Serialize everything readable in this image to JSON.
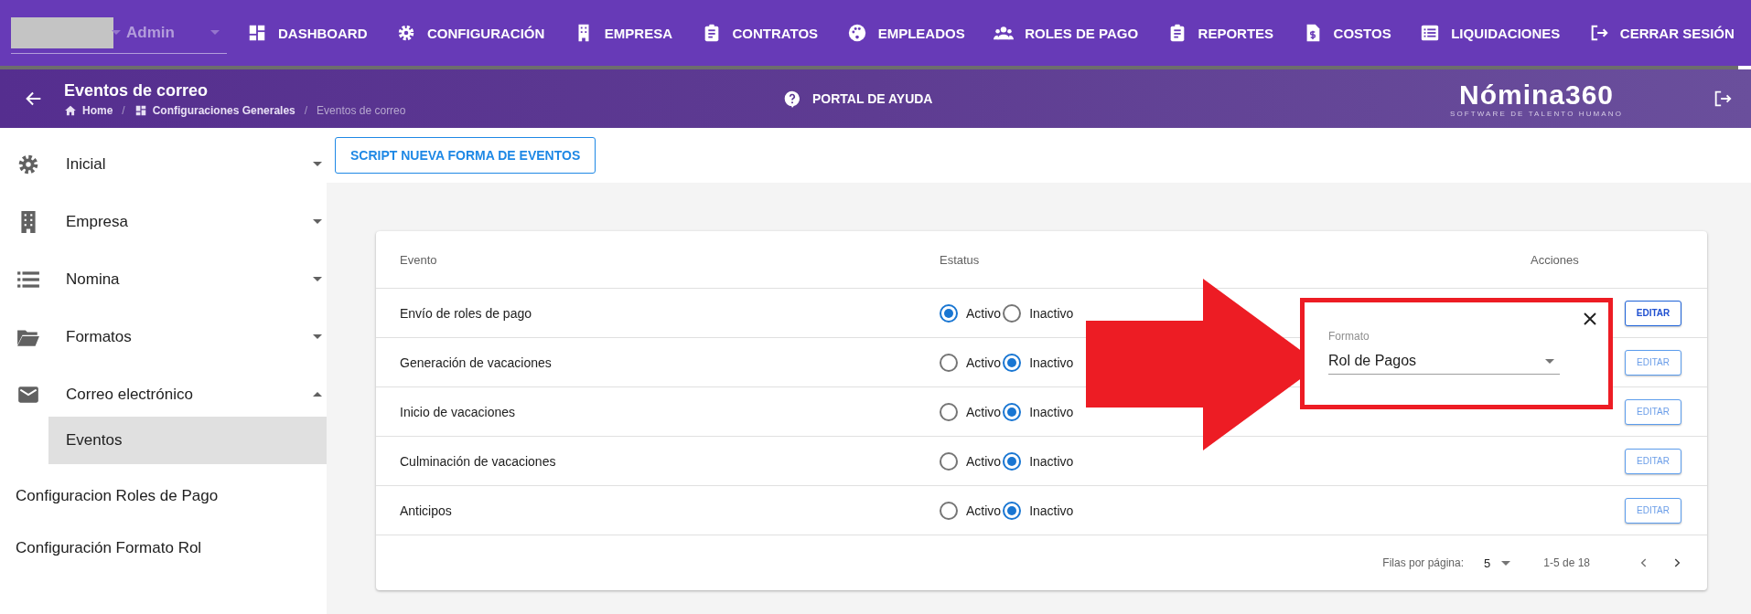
{
  "top_nav": {
    "user": {
      "value": "Admin"
    },
    "items": [
      {
        "label": "DASHBOARD"
      },
      {
        "label": "CONFIGURACIÓN"
      },
      {
        "label": "EMPRESA"
      },
      {
        "label": "CONTRATOS"
      },
      {
        "label": "EMPLEADOS"
      },
      {
        "label": "ROLES DE PAGO"
      },
      {
        "label": "REPORTES"
      },
      {
        "label": "COSTOS"
      },
      {
        "label": "LIQUIDACIONES"
      },
      {
        "label": "CERRAR SESIÓN"
      }
    ]
  },
  "header": {
    "title": "Eventos de correo",
    "breadcrumb": [
      {
        "label": "Home",
        "separator": "/"
      },
      {
        "label": "Configuraciones Generales",
        "separator": "/"
      },
      {
        "label": "Eventos de correo"
      }
    ],
    "help": "PORTAL DE AYUDA",
    "logo": {
      "name": "Nómina360",
      "tagline": "SOFTWARE DE TALENTO HUMANO"
    }
  },
  "sidebar": {
    "items": [
      {
        "kind": "group",
        "label": "Inicial",
        "expanded": false
      },
      {
        "kind": "group",
        "label": "Empresa",
        "expanded": false
      },
      {
        "kind": "group",
        "label": "Nomina",
        "expanded": false
      },
      {
        "kind": "group",
        "label": "Formatos",
        "expanded": false
      },
      {
        "kind": "group",
        "label": "Correo electrónico",
        "expanded": true,
        "children": [
          {
            "label": "Eventos",
            "selected": true
          }
        ]
      },
      {
        "kind": "link",
        "label": "Configuracion Roles de Pago"
      },
      {
        "kind": "link",
        "label": "Configuración Formato Rol"
      }
    ]
  },
  "toolbar": {
    "button": "SCRIPT NUEVA FORMA DE EVENTOS"
  },
  "table": {
    "columns": [
      "Evento",
      "Estatus",
      "Acciones"
    ],
    "rows": [
      {
        "evento": "Envío de roles de pago",
        "options": [
          {
            "label": "Activo",
            "selected": true
          },
          {
            "label": "Inactivo",
            "selected": false
          }
        ],
        "action": "EDITAR",
        "focused": true
      },
      {
        "evento": "Generación de vacaciones",
        "options": [
          {
            "label": "Activo",
            "selected": false
          },
          {
            "label": "Inactivo",
            "selected": true
          }
        ],
        "action": "EDITAR",
        "focused": false
      },
      {
        "evento": "Inicio de vacaciones",
        "options": [
          {
            "label": "Activo",
            "selected": false
          },
          {
            "label": "Inactivo",
            "selected": true
          }
        ],
        "action": "EDITAR",
        "focused": false
      },
      {
        "evento": "Culminación de vacaciones",
        "options": [
          {
            "label": "Activo",
            "selected": false
          },
          {
            "label": "Inactivo",
            "selected": true
          }
        ],
        "action": "EDITAR",
        "focused": false
      },
      {
        "evento": "Anticipos",
        "options": [
          {
            "label": "Activo",
            "selected": false
          },
          {
            "label": "Inactivo",
            "selected": true
          }
        ],
        "action": "EDITAR",
        "focused": false
      }
    ],
    "pagination": {
      "rows_per_page_label": "Filas por página:",
      "rows_per_page": "5",
      "range": "1-5 de 18"
    }
  },
  "popup": {
    "field_label": "Formato",
    "value": "Rol de Pagos"
  }
}
